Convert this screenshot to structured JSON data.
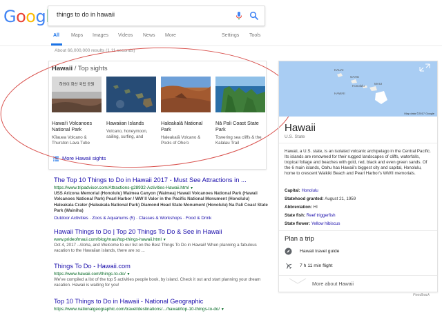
{
  "search": {
    "query": "things to do in hawaii",
    "logo_letters": [
      {
        "ch": "G",
        "color": "#4285f4"
      },
      {
        "ch": "o",
        "color": "#ea4335"
      },
      {
        "ch": "o",
        "color": "#fbbc05"
      },
      {
        "ch": "g",
        "color": "#4285f4"
      },
      {
        "ch": "l",
        "color": "#34a853"
      },
      {
        "ch": "e",
        "color": "#ea4335"
      }
    ]
  },
  "tabs": {
    "all": "All",
    "maps": "Maps",
    "images": "Images",
    "videos": "Videos",
    "news": "News",
    "more": "More",
    "settings": "Settings",
    "tools": "Tools"
  },
  "stats": "About 66,000,000 results (1.11 seconds)",
  "top_sights": {
    "title_bold": "Hawaii",
    "title_rest": " / Top sights",
    "items": [
      {
        "name": "Hawai'i Volcanoes National Park",
        "sub": "Kīlauea Volcano & Thurston Lava Tube",
        "img_text": "하와이 화산 국립 공원"
      },
      {
        "name": "Hawaiian Islands",
        "sub": "Volcano, honeymoon, sailing, surfing, and"
      },
      {
        "name": "Haleakalā National Park",
        "sub": "Haleakalā Volcano & Pools of Oheʻo"
      },
      {
        "name": "Nā Pali Coast State Park",
        "sub": "Towering sea cliffs & the Kalalau Trail"
      }
    ],
    "more_label": "More Hawaii sights"
  },
  "results": [
    {
      "title": "The Top 10 Things to Do in Hawaii 2017 - Must See Attractions in ...",
      "url": "https://www.tripadvisor.com/Attractions-g28932-Activities-Hawaii.html",
      "snippet": "USS Arizona Memorial (Honolulu) Waimea Canyon (Waimea) Hawaii Volcanoes National Park (Hawaii Volcanoes National Park) Pearl Harbor / WW II Valor in the Pacific National Monument (Honolulu) Haleakala Crater (Haleakala National Park) Diamond Head State Monument (Honolulu) Na Pali Coast State Park (Wainiha)",
      "links": "Outdoor Activities · Zoos & Aquariums (5) · Classes & Workshops · Food & Drink"
    },
    {
      "title": "Hawaii Things to Do | Top 20 Things To Do & See in Hawaii",
      "url": "www.prideofmaui.com/blog/maui/top-things-hawaii.html",
      "snippet": "Oct 4, 2017 - Aloha, and Welcome to our list on the Best Things To Do in Hawaii! When planning a fabulous vacation to the Hawaiian islands, there are so ..."
    },
    {
      "title": "Things To Do - Hawaii.com",
      "url": "https://www.hawaii.com/things-to-do/",
      "snippet": "We've compiled a list of the top 5 activities people book, by island. Check it out and start planning your dream vacation. Hawaii is waiting for you!"
    },
    {
      "title": "Top 10 Things to Do in Hawaii - National Geographic",
      "url": "https://www.nationalgeographic.com/travel/destinations/.../hawaii/top-10-things-to-do/"
    }
  ],
  "knowledge_panel": {
    "map_labels": {
      "kauai": "KAUAI",
      "oahu": "OAHU",
      "honolulu": "Honolulu",
      "maui": "MAUI",
      "hawaii": "HAWAII",
      "credit": "Map data ©2017 Google"
    },
    "title": "Hawaii",
    "subtitle": "U.S. State",
    "description": "Hawaii, a U.S. state, is an isolated volcanic archipelago in the Central Pacific. Its islands are renowned for their rugged landscapes of cliffs, waterfalls, tropical foliage and beaches with gold, red, black and even green sands. Of the 6 main islands, Oahu has Hawaii's biggest city and capital, Honolulu, home to crescent Waikiki Beach and Pearl Harbor's WWII memorials.",
    "facts": [
      {
        "label": "Capital:",
        "value": "Honolulu",
        "link": true
      },
      {
        "label": "Statehood granted:",
        "value": "August 21, 1959",
        "link": false
      },
      {
        "label": "Abbreviation:",
        "value": "HI",
        "link": false
      },
      {
        "label": "State fish:",
        "value": "Reef triggerfish",
        "link": true
      },
      {
        "label": "State flower:",
        "value": "Yellow hibiscus",
        "link": true
      }
    ],
    "plan_trip": "Plan a trip",
    "travel_guide": "Hawaii travel guide",
    "flight": "7 h 11 min flight",
    "more_about": "More about Hawaii"
  },
  "feedback": "Feedback"
}
